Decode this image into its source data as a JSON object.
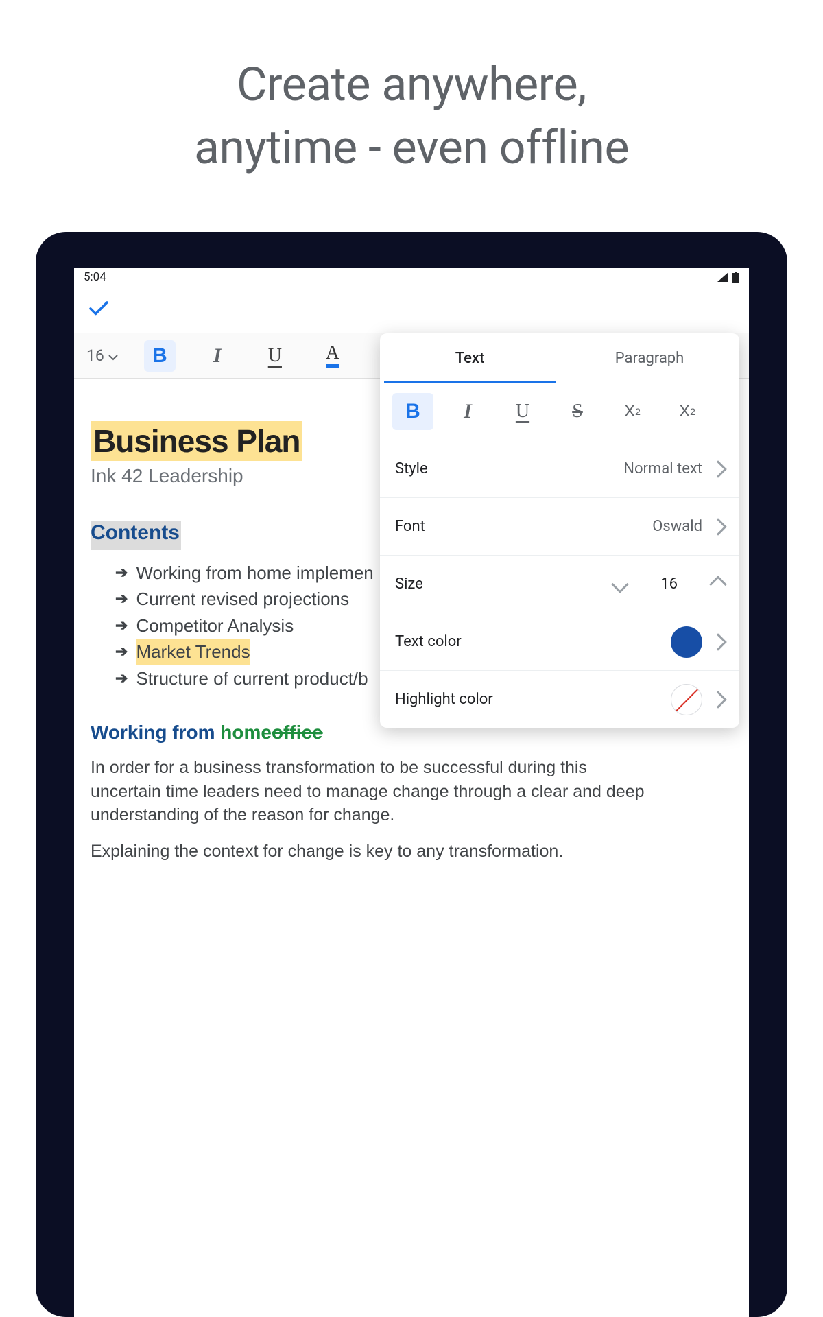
{
  "headline": "Create anywhere,\nanytime - even offline",
  "status": {
    "time": "5:04"
  },
  "toolbar": {
    "font_size": "16",
    "bold": "B",
    "italic": "I",
    "underline": "U",
    "colorA": "A"
  },
  "doc": {
    "title": "Business Plan",
    "subtitle": "Ink 42 Leadership",
    "contents_heading": "Contents",
    "bullets": [
      "Working from home implemen",
      "Current revised projections",
      "Competitor Analysis",
      "Market Trends",
      "Structure of current product/b"
    ],
    "section_heading_prefix": "Working from ",
    "section_heading_home": "home",
    "section_heading_office": "office",
    "para1": "In order for a business transformation to be successful during this uncertain time leaders need to manage change through a clear and deep understanding of the reason for change.",
    "para2": "Explaining the context for change is key to any transformation."
  },
  "panel": {
    "tabs": {
      "text": "Text",
      "paragraph": "Paragraph"
    },
    "format": {
      "bold": "B",
      "italic": "I",
      "underline": "U",
      "strike": "S",
      "sup": "X",
      "sub": "X"
    },
    "style": {
      "label": "Style",
      "value": "Normal text"
    },
    "font": {
      "label": "Font",
      "value": "Oswald"
    },
    "size": {
      "label": "Size",
      "value": "16"
    },
    "text_color": {
      "label": "Text color",
      "value": "#174ea6"
    },
    "highlight_color": {
      "label": "Highlight color",
      "value": "none"
    }
  }
}
